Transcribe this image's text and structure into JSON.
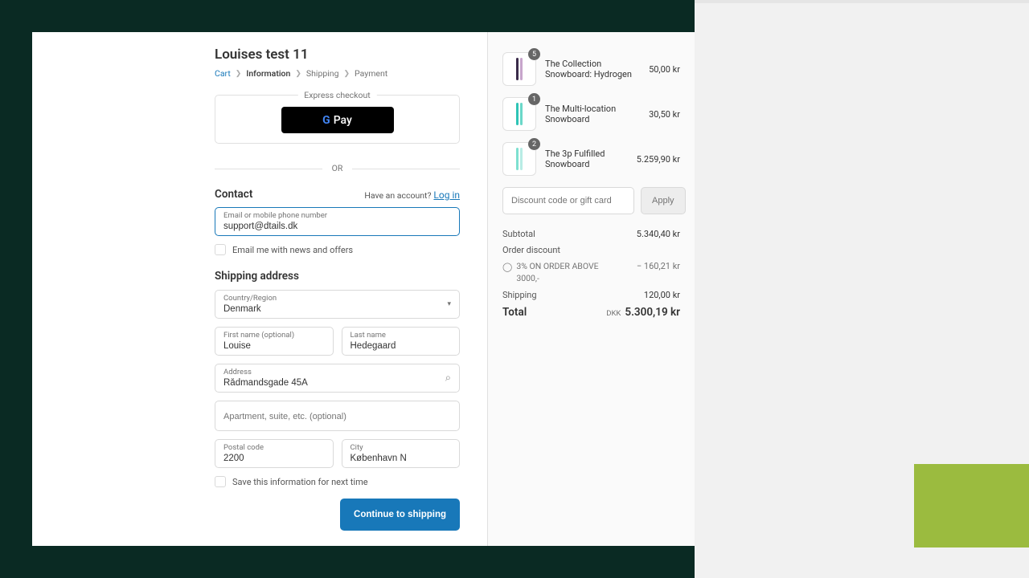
{
  "store_title": "Louises test 11",
  "breadcrumb": {
    "cart": "Cart",
    "info": "Information",
    "shipping": "Shipping",
    "payment": "Payment"
  },
  "express": {
    "label": "Express checkout",
    "gpay": "Pay"
  },
  "or": "OR",
  "contact": {
    "title": "Contact",
    "have_account": "Have an account?",
    "login": "Log in",
    "email_label": "Email or mobile phone number",
    "email_value": "support@dtails.dk",
    "news_opt": "Email me with news and offers"
  },
  "shipping": {
    "title": "Shipping address",
    "country_label": "Country/Region",
    "country_value": "Denmark",
    "first_label": "First name (optional)",
    "first_value": "Louise",
    "last_label": "Last name",
    "last_value": "Hedegaard",
    "address_label": "Address",
    "address_value": "Rådmandsgade 45A",
    "apt_placeholder": "Apartment, suite, etc. (optional)",
    "postal_label": "Postal code",
    "postal_value": "2200",
    "city_label": "City",
    "city_value": "København N",
    "save": "Save this information for next time"
  },
  "continue": "Continue to shipping",
  "cart": {
    "items": [
      {
        "name": "The Collection Snowboard: Hydrogen",
        "qty": "5",
        "price": "50,00 kr",
        "colors": [
          "#3a2b4a",
          "#c7a5cc"
        ]
      },
      {
        "name": "The Multi-location Snowboard",
        "qty": "1",
        "price": "30,50 kr",
        "colors": [
          "#2ec4b6",
          "#6bd8c9"
        ]
      },
      {
        "name": "The 3p Fulfilled Snowboard",
        "qty": "2",
        "price": "5.259,90 kr",
        "colors": [
          "#7de0d0",
          "#b8ece5"
        ]
      }
    ],
    "discount_placeholder": "Discount code or gift card",
    "apply": "Apply",
    "subtotal_label": "Subtotal",
    "subtotal_value": "5.340,40 kr",
    "order_discount_label": "Order discount",
    "discount_name": "3% ON ORDER ABOVE 3000,-",
    "discount_value": "− 160,21 kr",
    "shipping_label": "Shipping",
    "shipping_value": "120,00 kr",
    "total_label": "Total",
    "currency": "DKK",
    "total_value": "5.300,19 kr"
  }
}
